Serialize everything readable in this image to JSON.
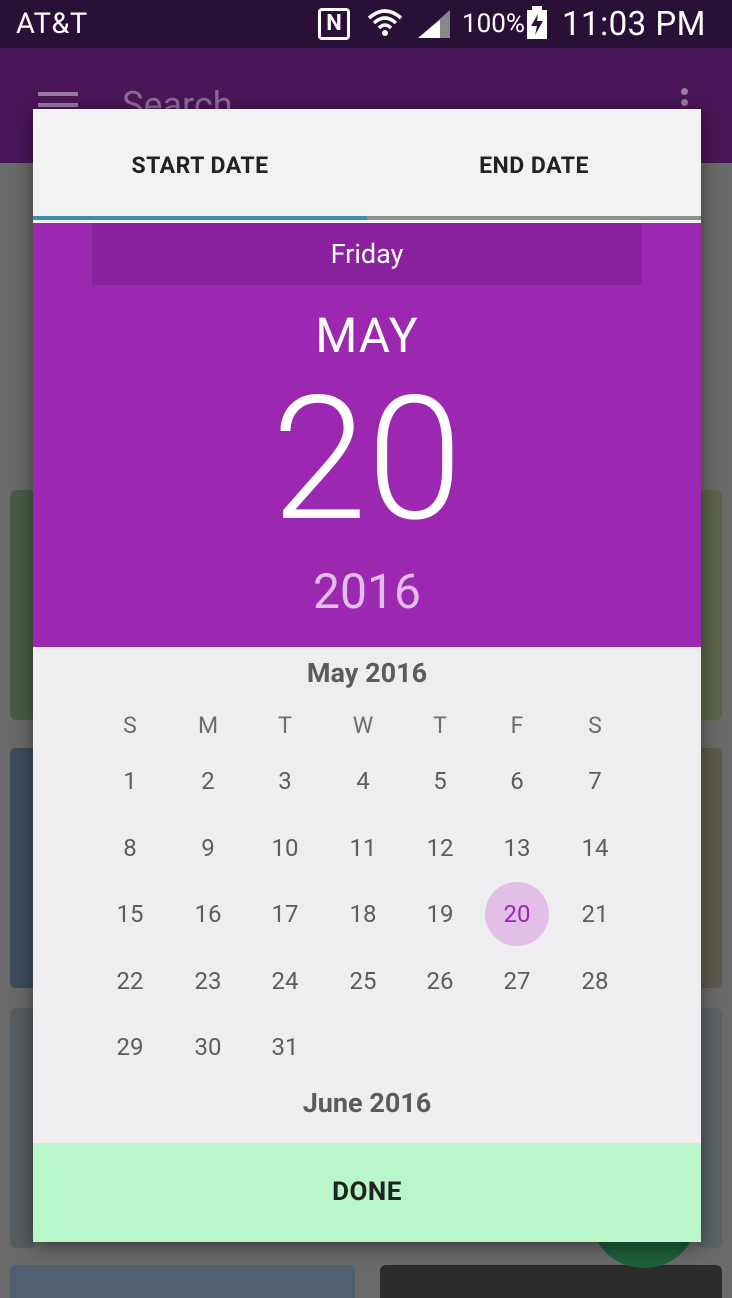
{
  "status_bar": {
    "carrier": "AT&T",
    "nfc_label": "N",
    "battery_percent": "100%",
    "time": "11:03 PM"
  },
  "background_app": {
    "search_placeholder": "Search"
  },
  "dialog": {
    "tabs": [
      {
        "label": "START DATE",
        "active": true
      },
      {
        "label": "END DATE",
        "active": false
      }
    ],
    "header": {
      "weekday": "Friday",
      "month": "MAY",
      "day": "20",
      "year": "2016"
    },
    "calendar": {
      "month_title": "May 2016",
      "weekday_headers": [
        "S",
        "M",
        "T",
        "W",
        "T",
        "F",
        "S"
      ],
      "weeks": [
        [
          "1",
          "2",
          "3",
          "4",
          "5",
          "6",
          "7"
        ],
        [
          "8",
          "9",
          "10",
          "11",
          "12",
          "13",
          "14"
        ],
        [
          "15",
          "16",
          "17",
          "18",
          "19",
          "20",
          "21"
        ],
        [
          "22",
          "23",
          "24",
          "25",
          "26",
          "27",
          "28"
        ],
        [
          "29",
          "30",
          "31",
          "",
          "",
          "",
          ""
        ]
      ],
      "selected_day": "20",
      "next_month_title": "June 2016"
    },
    "done_label": "DONE"
  },
  "colors": {
    "header_purple": "#9c27b0",
    "selected_circle": "#e1bfe6",
    "done_green": "#b9f6ca",
    "tab_indicator_active": "#3d8fb0"
  }
}
